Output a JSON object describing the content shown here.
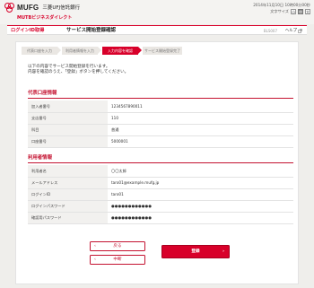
{
  "header": {
    "logo_text": "MUFG",
    "bank_name": "三菱UFJ信託銀行",
    "service_name": "MUTBビジネスダイレクト",
    "datetime": "2014年11月10日 10時00分00秒",
    "text_size_label": "文字サイズ",
    "text_size_options": [
      "小",
      "中",
      "大"
    ]
  },
  "nav": {
    "login_label": "ログインID取得",
    "page_title": "サービス開始登録確認",
    "screen_code": "BLS007",
    "help_label": "ヘルプ"
  },
  "steps": [
    "代表口座を入力",
    "利用者情報を入力",
    "入力内容を確認",
    "サービス開始登録完了"
  ],
  "intro": {
    "line1": "以下の内容でサービス開始登録を行います。",
    "line2": "内容を確認のうえ、「登録」ボタンを押してください。"
  },
  "account_section": {
    "title": "代表口座情報",
    "rows": [
      {
        "label": "加入者番号",
        "value": "1234567890011"
      },
      {
        "label": "支店番号",
        "value": "110"
      },
      {
        "label": "科目",
        "value": "普通"
      },
      {
        "label": "口座番号",
        "value": "5000001"
      }
    ]
  },
  "user_section": {
    "title": "利用者情報",
    "rows": [
      {
        "label": "利用者名",
        "value": "〇〇太郎"
      },
      {
        "label": "メールアドレス",
        "value": "taro01@example.mufg.jp"
      },
      {
        "label": "ログインID",
        "value": "taro01"
      },
      {
        "label": "ログインパスワード",
        "value": "●●●●●●●●●●●●"
      },
      {
        "label": "確認用パスワード",
        "value": "●●●●●●●●●●●●"
      }
    ]
  },
  "buttons": {
    "back": "戻る",
    "cancel": "中断",
    "register": "登録"
  },
  "colors": {
    "brand": "#d8002a",
    "section_title": "#c41230",
    "background": "#efeeeb"
  }
}
